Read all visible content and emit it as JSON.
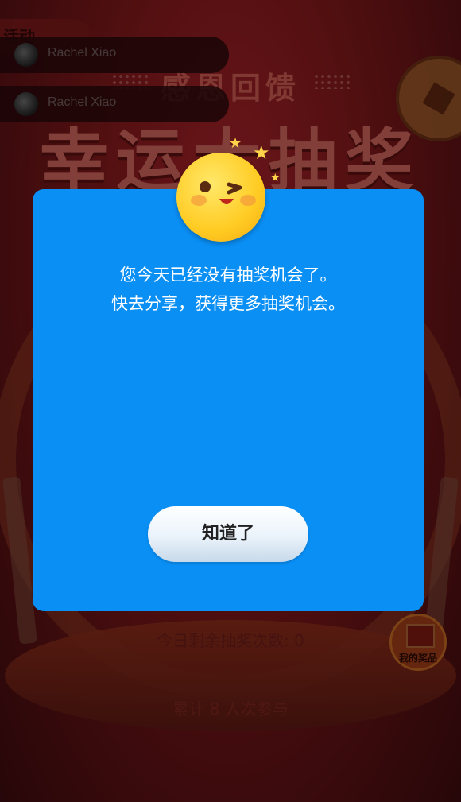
{
  "background": {
    "title_small": "感恩回馈",
    "title_big": "幸运大抽奖",
    "remaining_draws": "今日剩余抽奖次数: 0",
    "total_participants": "累计 8 人次参与",
    "prize_button_label": "我的奖品",
    "activity_button_label": "活动",
    "feed": [
      {
        "name": "Rachel Xiao"
      },
      {
        "name": "Rachel Xiao"
      }
    ]
  },
  "dialog": {
    "message_line1": "您今天已经没有抽奖机会了。",
    "message_line2": "快去分享，获得更多抽奖机会。",
    "ok_label": "知道了"
  },
  "colors": {
    "dialog_bg": "#0a8ff5",
    "backdrop": "#7a1719"
  },
  "icons": [
    "wink-emoji-icon",
    "star-icon",
    "gift-box-icon",
    "avatar"
  ]
}
